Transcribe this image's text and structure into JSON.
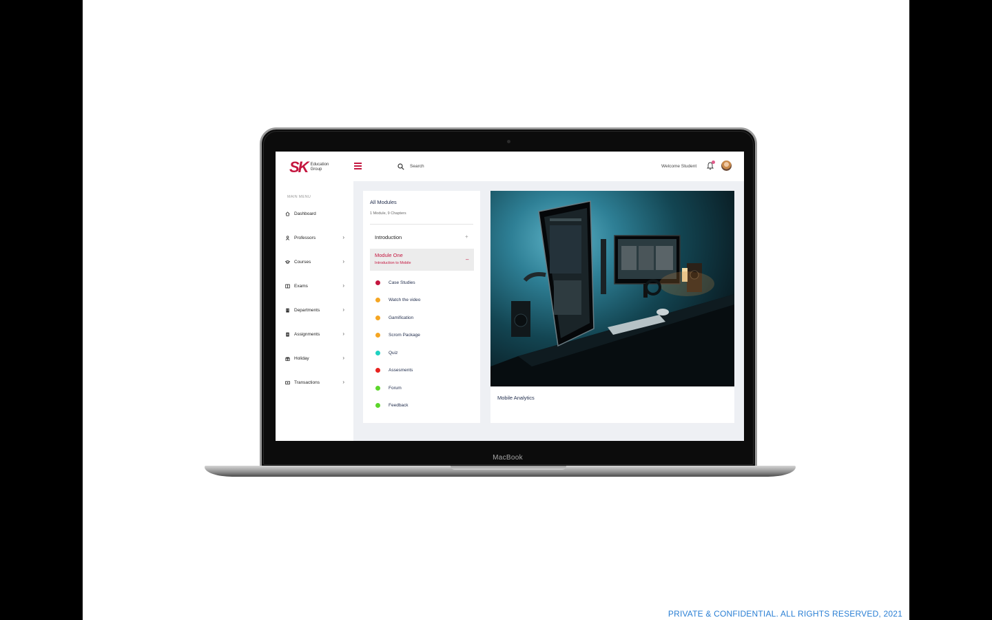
{
  "footer": {
    "text": "PRIVATE & CONFIDENTIAL. ALL RIGHTS RESERVED, 2021"
  },
  "device": {
    "brand": "MacBook"
  },
  "header": {
    "logo_mark": "SK",
    "logo_line1": "Education",
    "logo_line2": "Group",
    "search_placeholder": "Search",
    "welcome": "Welcome Student"
  },
  "sidebar": {
    "title": "MAIN MENU",
    "items": [
      {
        "label": "Dashboard",
        "icon": "home-icon",
        "has_chevron": false
      },
      {
        "label": "Professors",
        "icon": "user-icon",
        "has_chevron": true
      },
      {
        "label": "Courses",
        "icon": "graduation-cap-icon",
        "has_chevron": true
      },
      {
        "label": "Exams",
        "icon": "book-icon",
        "has_chevron": true
      },
      {
        "label": "Departments",
        "icon": "building-icon",
        "has_chevron": true
      },
      {
        "label": "Assignments",
        "icon": "clipboard-icon",
        "has_chevron": true
      },
      {
        "label": "Holiday",
        "icon": "gift-icon",
        "has_chevron": true
      },
      {
        "label": "Transactions",
        "icon": "money-icon",
        "has_chevron": true
      }
    ]
  },
  "modules": {
    "title": "All Modules",
    "subtitle": "1 Module, 9 Chapters",
    "intro": {
      "label": "Introduction",
      "toggle": "+"
    },
    "active": {
      "title": "Module One",
      "subtitle": "Introduction to Mobile",
      "toggle": "–"
    },
    "chapters": [
      {
        "label": "Case Studies",
        "color": "#c4163f"
      },
      {
        "label": "Watch the video",
        "color": "#f5a623"
      },
      {
        "label": "Gamification",
        "color": "#f5a623"
      },
      {
        "label": "Scrom Package",
        "color": "#f5a623"
      },
      {
        "label": "Quiz",
        "color": "#1fd1c1"
      },
      {
        "label": "Assesments",
        "color": "#e8231f"
      },
      {
        "label": "Forum",
        "color": "#5cd62b"
      },
      {
        "label": "Feedback",
        "color": "#5cd62b"
      }
    ]
  },
  "video": {
    "caption": "Mobile Analytics"
  }
}
